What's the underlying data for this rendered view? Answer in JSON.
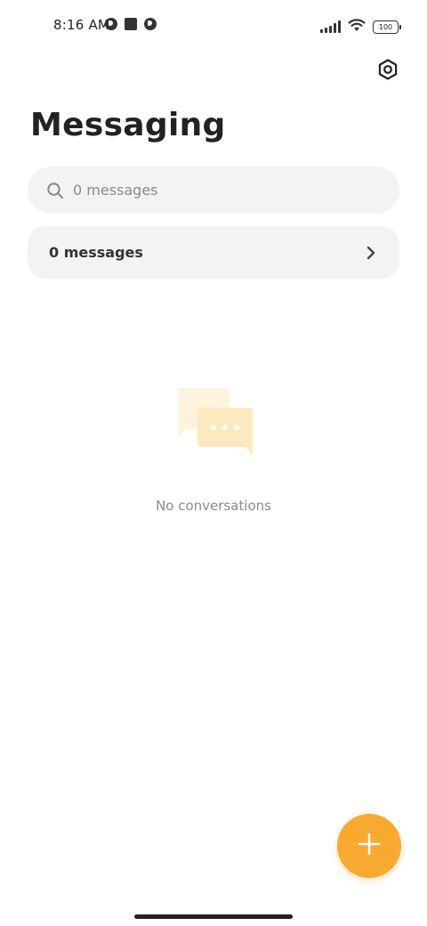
{
  "status_bar": {
    "time": "8:16 AM",
    "battery_level": "100",
    "icons": [
      "notification-app-icon",
      "notification-square-icon",
      "notification-app-icon",
      "signal-icon",
      "wifi-icon",
      "battery-icon"
    ]
  },
  "header": {
    "title": "Messaging",
    "settings_icon": "settings-icon"
  },
  "search": {
    "placeholder": "0 messages",
    "icon": "search-icon"
  },
  "messages_row": {
    "label": "0 messages",
    "icon": "chevron-right-icon"
  },
  "empty_state": {
    "icon": "chat-bubbles-icon",
    "text": "No conversations"
  },
  "fab": {
    "icon": "plus-icon",
    "color": "#f7a930"
  },
  "colors": {
    "accent": "#f7a930",
    "illustration_light": "#fef3dc",
    "illustration_mid": "#fde9bf",
    "surface": "#f3f3f3"
  }
}
